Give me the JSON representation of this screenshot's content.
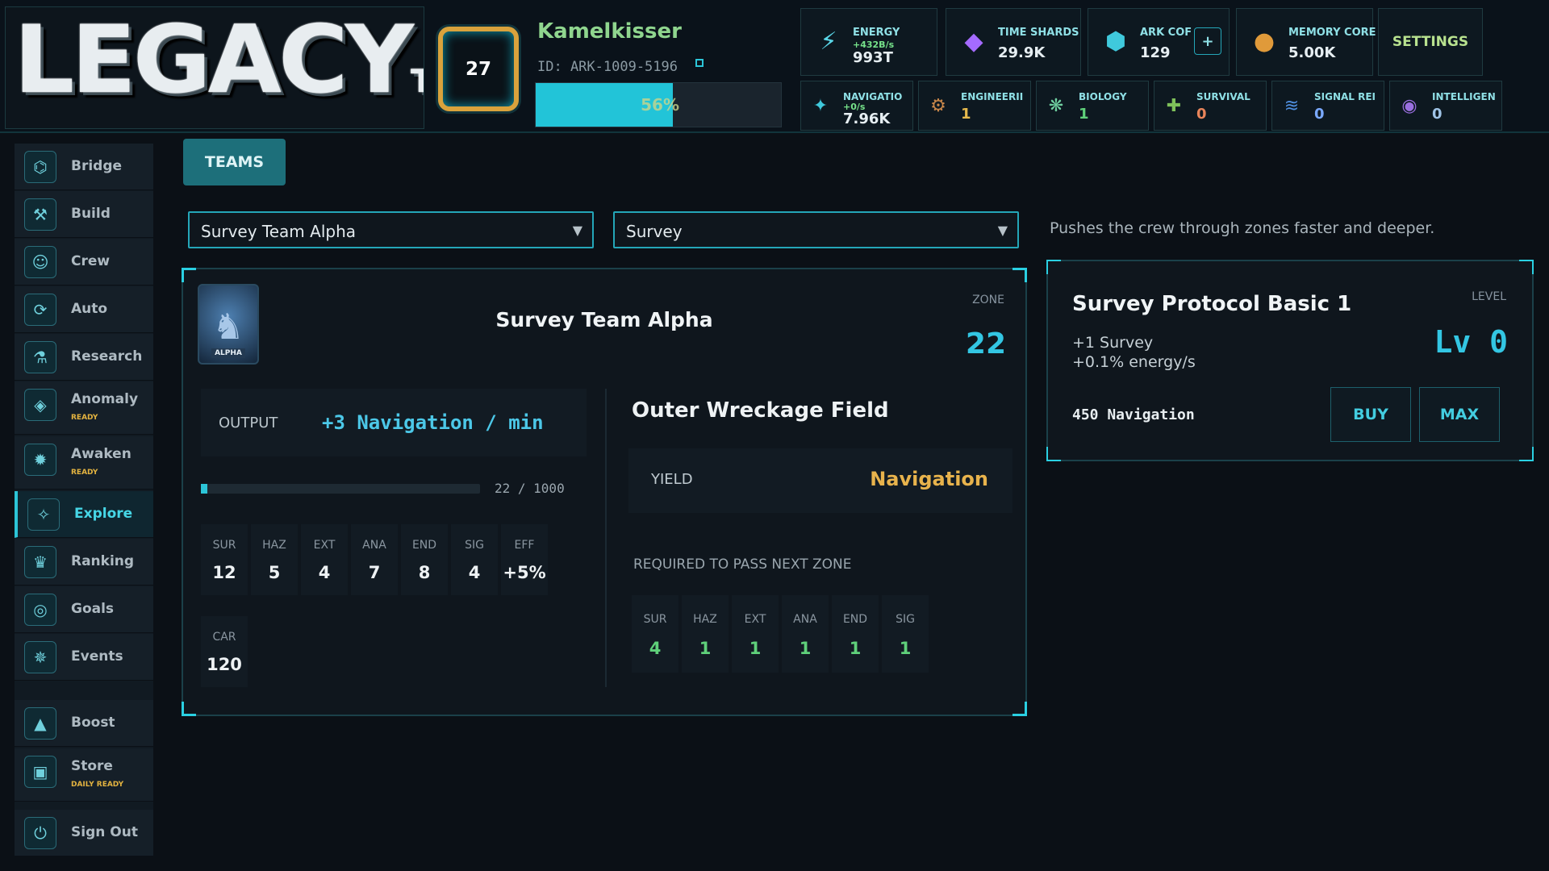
{
  "logo": {
    "text": "LEGACY",
    "suffix": "T"
  },
  "player": {
    "level": "27",
    "name": "Kamelkisser",
    "id": "ID: ARK-1009-5196",
    "xp_percent": 56,
    "xp_label": "56%"
  },
  "resources": [
    {
      "name": "ENERGY",
      "rate": "+432B/s",
      "value": "993T",
      "icon": "lightning-icon",
      "glyph": "⚡",
      "color": "#5ad7e8"
    },
    {
      "name": "TIME SHARDS",
      "rate": "",
      "value": "29.9K",
      "icon": "crystal-icon",
      "glyph": "◆",
      "color": "#a56bff"
    },
    {
      "name": "ARK COF",
      "rate": "",
      "value": "129",
      "icon": "ark-core-icon",
      "glyph": "⬢",
      "color": "#3fc9dc"
    },
    {
      "name": "MEMORY CORE",
      "rate": "",
      "value": "5.00K",
      "icon": "memory-core-icon",
      "glyph": "●",
      "color": "#e09a3a"
    }
  ],
  "settings_label": "SETTINGS",
  "plus_label": "+",
  "stats": [
    {
      "name": "NAVIGATIO",
      "rate": "+0/s",
      "value": "7.96K",
      "icon": "compass-icon",
      "glyph": "✦",
      "color": "#3fc9dc",
      "val_color": "#e6eef2"
    },
    {
      "name": "ENGINEERII",
      "value": "1",
      "icon": "engineering-icon",
      "glyph": "⚙",
      "color": "#c9874a",
      "val_color": "#e5b94c"
    },
    {
      "name": "BIOLOGY",
      "value": "1",
      "icon": "biology-icon",
      "glyph": "❋",
      "color": "#6fd0a0",
      "val_color": "#5fd07a"
    },
    {
      "name": "SURVIVAL",
      "value": "0",
      "icon": "survival-icon",
      "glyph": "✚",
      "color": "#7ec05a",
      "val_color": "#e8845a"
    },
    {
      "name": "SIGNAL REI",
      "value": "0",
      "icon": "signal-icon",
      "glyph": "≋",
      "color": "#4f8fe0",
      "val_color": "#7aa9ff"
    },
    {
      "name": "INTELLIGEN",
      "value": "0",
      "icon": "intelligence-icon",
      "glyph": "◉",
      "color": "#9a6fe0",
      "val_color": "#9fc3e6"
    }
  ],
  "nav": [
    {
      "label": "Bridge",
      "sub": "",
      "icon": "bridge-icon",
      "glyph": "⌬",
      "active": false
    },
    {
      "label": "Build",
      "sub": "",
      "icon": "build-icon",
      "glyph": "⚒",
      "active": false
    },
    {
      "label": "Crew",
      "sub": "",
      "icon": "crew-icon",
      "glyph": "☺",
      "active": false
    },
    {
      "label": "Auto",
      "sub": "",
      "icon": "auto-icon",
      "glyph": "⟳",
      "active": false
    },
    {
      "label": "Research",
      "sub": "",
      "icon": "research-icon",
      "glyph": "⚗",
      "active": false
    },
    {
      "label": "Anomaly",
      "sub": "READY",
      "icon": "anomaly-icon",
      "glyph": "◈",
      "active": false
    },
    {
      "label": "Awaken",
      "sub": "READY",
      "icon": "awaken-icon",
      "glyph": "✹",
      "active": false
    },
    {
      "label": "Explore",
      "sub": "",
      "icon": "explore-icon",
      "glyph": "✧",
      "active": true
    },
    {
      "label": "Ranking",
      "sub": "",
      "icon": "ranking-icon",
      "glyph": "♛",
      "active": false
    },
    {
      "label": "Goals",
      "sub": "",
      "icon": "goals-icon",
      "glyph": "◎",
      "active": false
    },
    {
      "label": "Events",
      "sub": "",
      "icon": "events-icon",
      "glyph": "✵",
      "active": false
    },
    {
      "label": "Boost",
      "sub": "",
      "icon": "boost-icon",
      "glyph": "▲",
      "active": false
    },
    {
      "label": "Store",
      "sub": "DAILY READY",
      "icon": "store-icon",
      "glyph": "▣",
      "active": false
    },
    {
      "label": "Sign Out",
      "sub": "",
      "icon": "sign-out-icon",
      "glyph": "⏻",
      "active": false
    }
  ],
  "main": {
    "tab_label": "TEAMS",
    "team_select": "Survey Team Alpha",
    "mode_select": "Survey",
    "mode_description": "Pushes the crew through zones faster and deeper."
  },
  "team": {
    "avatar_text": "ALPHA",
    "name": "Survey Team Alpha",
    "zone_label": "ZONE",
    "zone": "22",
    "output_label": "OUTPUT",
    "output_value": "+3 Navigation / min",
    "progress_current": 22,
    "progress_max": 1000,
    "progress_text": "22 / 1000",
    "stats": [
      {
        "label": "SUR",
        "value": "12"
      },
      {
        "label": "HAZ",
        "value": "5"
      },
      {
        "label": "EXT",
        "value": "4"
      },
      {
        "label": "ANA",
        "value": "7"
      },
      {
        "label": "END",
        "value": "8"
      },
      {
        "label": "SIG",
        "value": "4"
      },
      {
        "label": "EFF",
        "value": "+5%"
      }
    ],
    "car_label": "CAR",
    "car_value": "120"
  },
  "zone": {
    "name": "Outer Wreckage Field",
    "yield_label": "YIELD",
    "yield_value": "Navigation",
    "required_title": "REQUIRED TO PASS NEXT ZONE",
    "required": [
      {
        "label": "SUR",
        "value": "4"
      },
      {
        "label": "HAZ",
        "value": "1"
      },
      {
        "label": "EXT",
        "value": "1"
      },
      {
        "label": "ANA",
        "value": "1"
      },
      {
        "label": "END",
        "value": "1"
      },
      {
        "label": "SIG",
        "value": "1"
      }
    ]
  },
  "upgrade": {
    "title": "Survey Protocol Basic 1",
    "level_label": "LEVEL",
    "level_value": "Lv 0",
    "effect_1": "+1 Survey",
    "effect_2": "+0.1% energy/s",
    "cost": "450 Navigation",
    "buy_label": "BUY",
    "max_label": "MAX"
  }
}
